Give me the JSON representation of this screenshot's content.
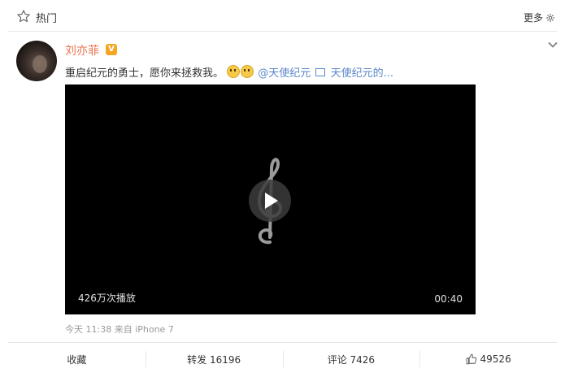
{
  "header": {
    "title": "热门",
    "more_label": "更多"
  },
  "post": {
    "username": "刘亦菲",
    "badge": "V",
    "text_plain": "重启纪元的勇士，愿你来拯救我。",
    "mention": "@天使纪元",
    "video_link": "天使纪元的...",
    "video": {
      "views": "426万次播放",
      "duration": "00:40"
    },
    "meta": "今天 11:38 来自 iPhone 7"
  },
  "actions": {
    "favorite": "收藏",
    "repost": "转发 16196",
    "comment": "评论 7426",
    "like": "49526"
  },
  "colors": {
    "username": "#eb7350",
    "link": "#5a86c9",
    "badge": "#f5a623"
  }
}
